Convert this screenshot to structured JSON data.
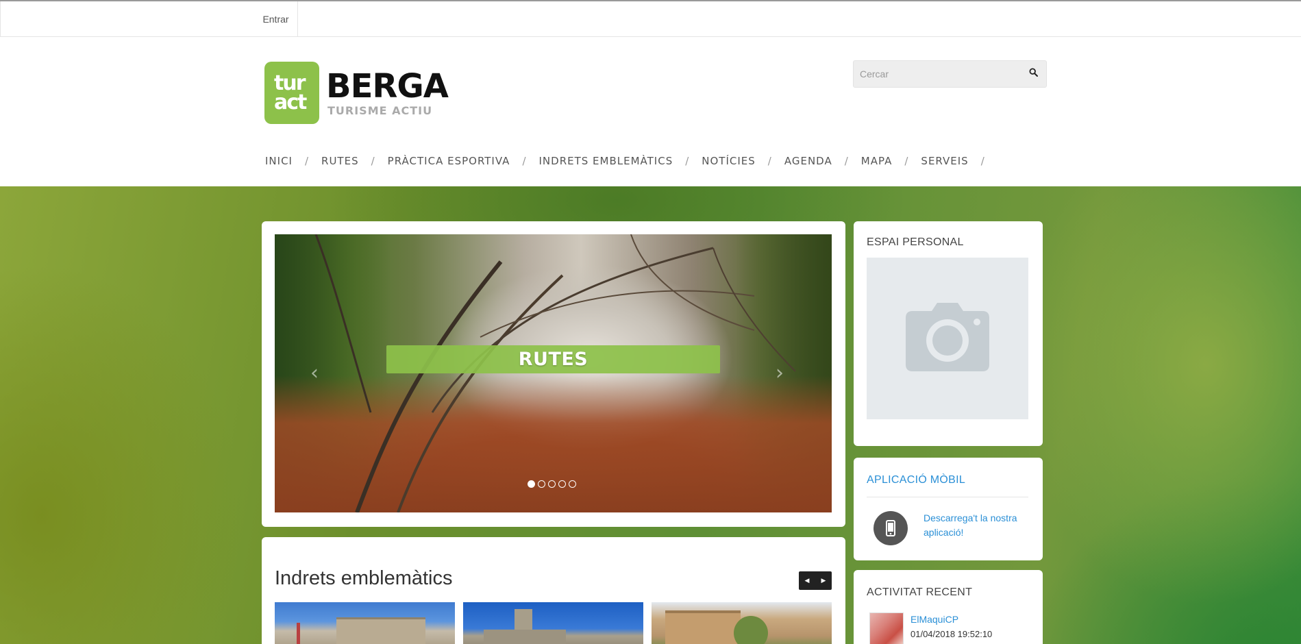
{
  "topbar": {
    "login_label": "Entrar"
  },
  "logo": {
    "badge_text": "tur act",
    "name": "BERGA",
    "tagline": "TURISME ACTIU",
    "brand_color": "#8dc14a"
  },
  "search": {
    "placeholder": "Cercar",
    "value": "",
    "icon": "search-icon"
  },
  "nav": {
    "items": [
      "INICI",
      "RUTES",
      "PRÀCTICA ESPORTIVA",
      "INDRETS EMBLEMÀTICS",
      "NOTÍCIES",
      "AGENDA",
      "MAPA",
      "SERVEIS"
    ],
    "separator": "/"
  },
  "slider": {
    "caption": "RUTES",
    "prev_icon": "chevron-left-icon",
    "next_icon": "chevron-right-icon",
    "slide_count": 5,
    "active_slide": 1
  },
  "places": {
    "title": "Indrets emblemàtics",
    "prev_icon": "caret-left-icon",
    "next_icon": "caret-right-icon"
  },
  "personal": {
    "title": "ESPAI PERSONAL",
    "photo_icon": "camera-icon"
  },
  "app": {
    "title": "APLICACIÓ MÒBIL",
    "link_text": "Descarrega't la nostra aplicació!",
    "icon": "mobile-phone-icon",
    "accent_color": "#2a8fd6"
  },
  "activity": {
    "title": "ACTIVITAT RECENT",
    "user": "ElMaquiCP",
    "timestamp": "01/04/2018 19:52:10"
  }
}
